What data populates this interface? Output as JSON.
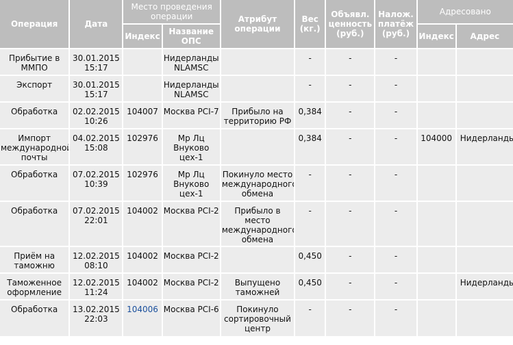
{
  "header": {
    "operation": "Операция",
    "date": "Дата",
    "place_group": "Место проведения операции",
    "index": "Индекс",
    "ops_name": "Название ОПС",
    "attribute": "Атрибут операции",
    "weight": "Вес (кг.)",
    "declared_value": "Объявл. ценность (руб.)",
    "cod": "Налож. платёж (руб.)",
    "addressed_group": "Адресовано",
    "addr_index": "Индекс",
    "address": "Адрес"
  },
  "rows": [
    {
      "operation": "Прибытие в ММПО",
      "date": "30.01.2015 15:17",
      "index": "",
      "ops": "Нидерланды NLAMSC",
      "attribute": "",
      "weight": "-",
      "value": "-",
      "cod": "-",
      "addr_index": "",
      "address": ""
    },
    {
      "operation": "Экспорт",
      "date": "30.01.2015 15:17",
      "index": "",
      "ops": "Нидерланды NLAMSC",
      "attribute": "",
      "weight": "-",
      "value": "-",
      "cod": "-",
      "addr_index": "",
      "address": ""
    },
    {
      "operation": "Обработка",
      "date": "02.02.2015 10:26",
      "index": "104007",
      "ops": "Москва PCI-7",
      "attribute": "Прибыло на территорию РФ",
      "weight": "0,384",
      "value": "-",
      "cod": "-",
      "addr_index": "",
      "address": ""
    },
    {
      "operation": "Импорт международной почты",
      "date": "04.02.2015 15:08",
      "index": "102976",
      "ops": "Мр Лц Внуково цех-1",
      "attribute": "",
      "weight": "0,384",
      "value": "-",
      "cod": "-",
      "addr_index": "104000",
      "address": "Нидерланды"
    },
    {
      "operation": "Обработка",
      "date": "07.02.2015 10:39",
      "index": "102976",
      "ops": "Мр Лц Внуково цех-1",
      "attribute": "Покинуло место международного обмена",
      "weight": "-",
      "value": "-",
      "cod": "-",
      "addr_index": "",
      "address": ""
    },
    {
      "operation": "Обработка",
      "date": "07.02.2015 22:01",
      "index": "104002",
      "ops": "Москва PCI-2",
      "attribute": "Прибыло в место международного обмена",
      "weight": "-",
      "value": "-",
      "cod": "-",
      "addr_index": "",
      "address": ""
    },
    {
      "operation": "Приём на таможню",
      "date": "12.02.2015 08:10",
      "index": "104002",
      "ops": "Москва PCI-2",
      "attribute": "",
      "weight": "0,450",
      "value": "-",
      "cod": "-",
      "addr_index": "",
      "address": ""
    },
    {
      "operation": "Таможенное оформление",
      "date": "12.02.2015 11:24",
      "index": "104002",
      "ops": "Москва PCI-2",
      "attribute": "Выпущено таможней",
      "weight": "0,450",
      "value": "-",
      "cod": "-",
      "addr_index": "",
      "address": "Нидерланды"
    },
    {
      "operation": "Обработка",
      "date": "13.02.2015 22:03",
      "index": "104006",
      "ops": "Москва PCI-6",
      "attribute": "Покинуло сортировочный центр",
      "weight": "-",
      "value": "-",
      "cod": "-",
      "addr_index": "",
      "address": ""
    }
  ]
}
